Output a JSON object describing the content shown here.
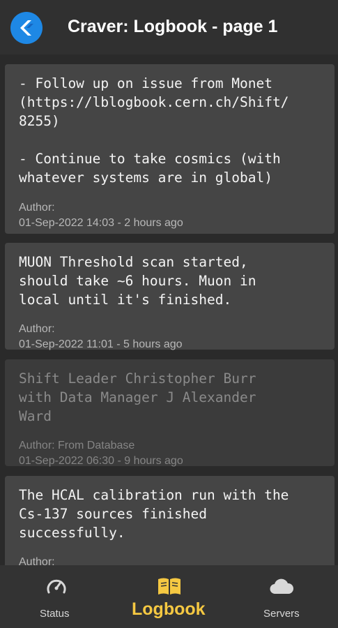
{
  "appbar": {
    "title": "Craver: Logbook - page 1",
    "logo_icon": "craver-logo-icon"
  },
  "entries": [
    {
      "text": "- Follow up on issue from Monet\n(https://lblogbook.cern.ch/Shift/\n8255)\n\n- Continue to take cosmics (with\nwhatever systems are in global)",
      "author": "Author:",
      "timestamp": "01-Sep-2022 14:03 - 2 hours ago",
      "faded": false
    },
    {
      "text": "MUON Threshold scan started,\nshould take ~6 hours. Muon in\nlocal until it's finished.",
      "author": "Author:",
      "timestamp": "01-Sep-2022 11:01 - 5 hours ago",
      "faded": false
    },
    {
      "text": "Shift Leader Christopher Burr\nwith Data Manager J Alexander\nWard",
      "author": "Author: From Database",
      "timestamp": "01-Sep-2022 06:30 - 9 hours ago",
      "faded": true
    },
    {
      "text": "The HCAL calibration run with the\nCs-137 sources finished\nsuccessfully.",
      "author": "Author:",
      "timestamp": "",
      "faded": false
    }
  ],
  "bottom_nav": {
    "items": [
      {
        "label": "Status",
        "icon": "speedometer-icon",
        "active": false
      },
      {
        "label": "Logbook",
        "icon": "book-open-icon",
        "active": true
      },
      {
        "label": "Servers",
        "icon": "cloud-icon",
        "active": false
      }
    ],
    "active_color": "#f5c842",
    "inactive_color": "#d8d8d8"
  },
  "colors": {
    "background": "#2a2a2a",
    "appbar": "#303030",
    "card": "#454545",
    "logo": "#1e88e5"
  }
}
